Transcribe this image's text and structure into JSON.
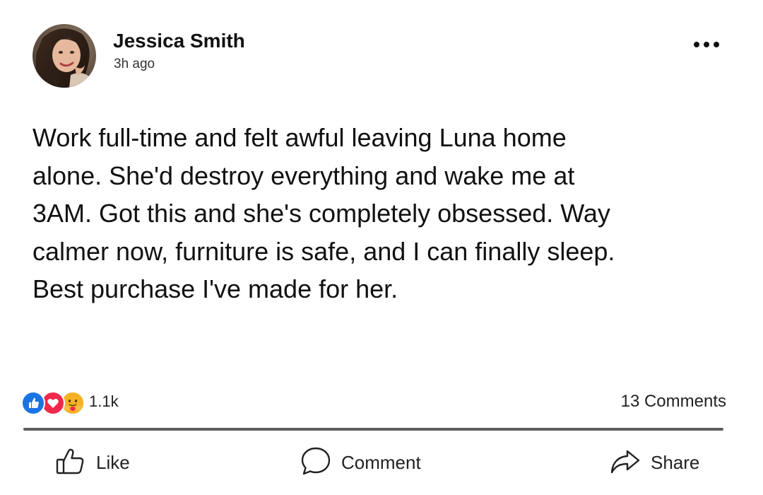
{
  "post": {
    "author": {
      "name": "Jessica Smith",
      "timestamp": "3h ago",
      "avatar_icon": "profile-photo"
    },
    "more_icon": "more-horizontal-icon",
    "text": "Work full-time and felt awful leaving Luna home\nalone. She'd destroy everything and wake me at\n3AM. Got this and she's completely obsessed. Way\ncalmer now, furniture is safe, and I can finally sleep.\nBest purchase I've made for her.",
    "stats": {
      "reactions": [
        "like",
        "love",
        "care"
      ],
      "reaction_count": "1.1k",
      "comments": "13 Comments"
    },
    "actions": {
      "like": "Like",
      "comment": "Comment",
      "share": "Share"
    },
    "colors": {
      "like": "#1b74e4",
      "love": "#f0284a",
      "care": "#f7b125",
      "divider": "#5f5f5f"
    }
  }
}
